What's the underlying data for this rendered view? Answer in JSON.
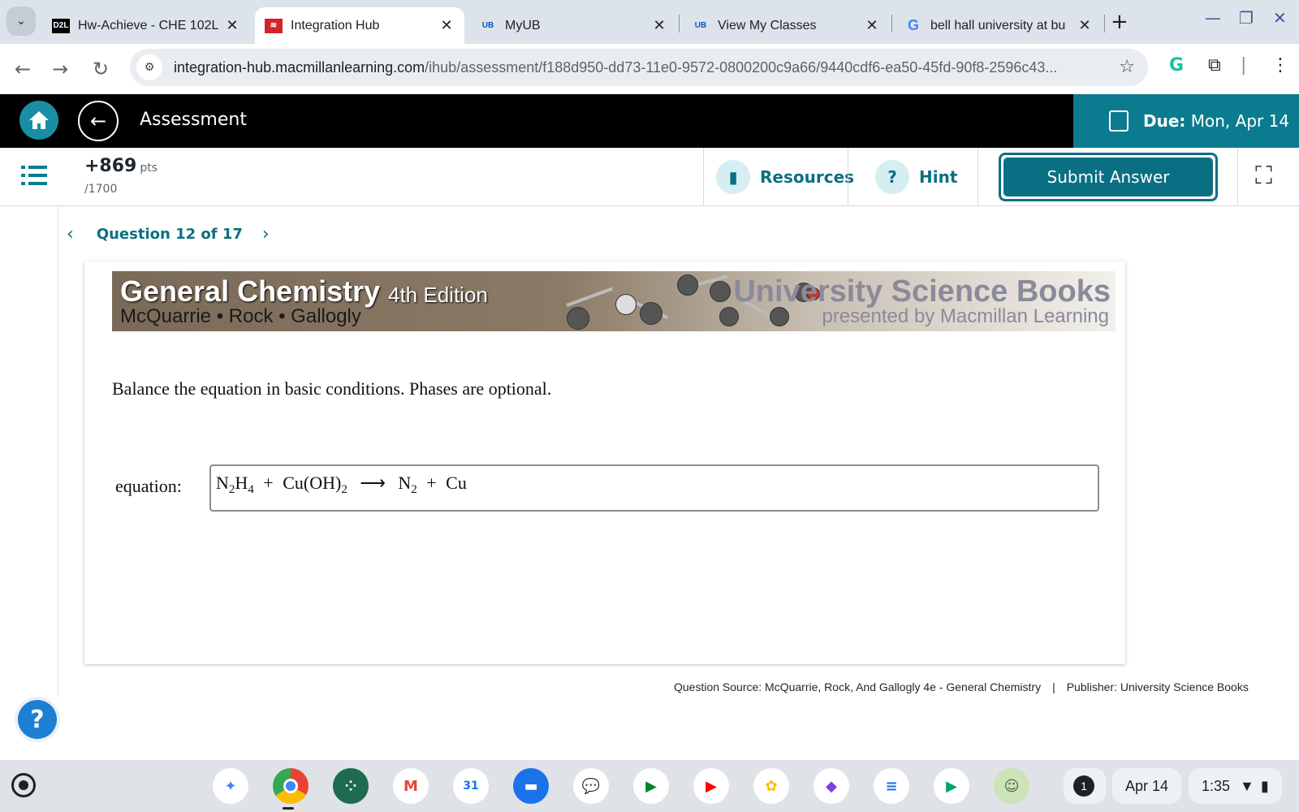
{
  "browser": {
    "tabs": [
      {
        "favicon": "D2L",
        "title": "Hw-Achieve - CHE 102L",
        "active": false
      },
      {
        "favicon": "macmillan-logo",
        "title": "Integration Hub",
        "active": true
      },
      {
        "favicon": "ub-logo",
        "title": "MyUB",
        "active": false
      },
      {
        "favicon": "ub-logo",
        "title": "View My Classes",
        "active": false
      },
      {
        "favicon": "google-g",
        "title": "bell hall university at bu",
        "active": false
      }
    ],
    "url_host": "integration-hub.macmillanlearning.com",
    "url_path": "/ihub/assessment/f188d950-dd73-11e0-9572-0800200c9a66/9440cdf6-ea50-45fd-90f8-2596c43..."
  },
  "header": {
    "title": "Assessment",
    "due_label": "Due:",
    "due_value": "Mon, Apr 14"
  },
  "toolbar": {
    "points": "+869",
    "points_unit": "pts",
    "points_total": "/1700",
    "resources_label": "Resources",
    "hint_label": "Hint",
    "submit_label": "Submit Answer"
  },
  "question": {
    "nav_label": "Question 12 of 17",
    "banner": {
      "title": "General Chemistry",
      "edition": "4th Edition",
      "authors": "McQuarrie • Rock • Gallogly",
      "publisher": "University Science Books",
      "presented": "presented by Macmillan Learning"
    },
    "prompt": "Balance the equation in basic conditions. Phases are optional.",
    "equation_label": "equation:",
    "equation": {
      "r1_a": "N",
      "r1_a_sub": "2",
      "r1_b": "H",
      "r1_b_sub": "4",
      "plus1": "+",
      "r2": "Cu(OH)",
      "r2_sub": "2",
      "arrow": "⟶",
      "p1": "N",
      "p1_sub": "2",
      "plus2": "+",
      "p2": "Cu"
    },
    "source": "Question Source: McQuarrie, Rock, And Gallogly 4e - General Chemistry",
    "publisher": "Publisher: University Science Books"
  },
  "help_label": "?",
  "shelf": {
    "notification_count": "1",
    "date": "Apr 14",
    "time": "1:35"
  },
  "colors": {
    "teal": "#0b6f83",
    "header_black": "#000000",
    "due_bg": "#0b7c8f"
  }
}
